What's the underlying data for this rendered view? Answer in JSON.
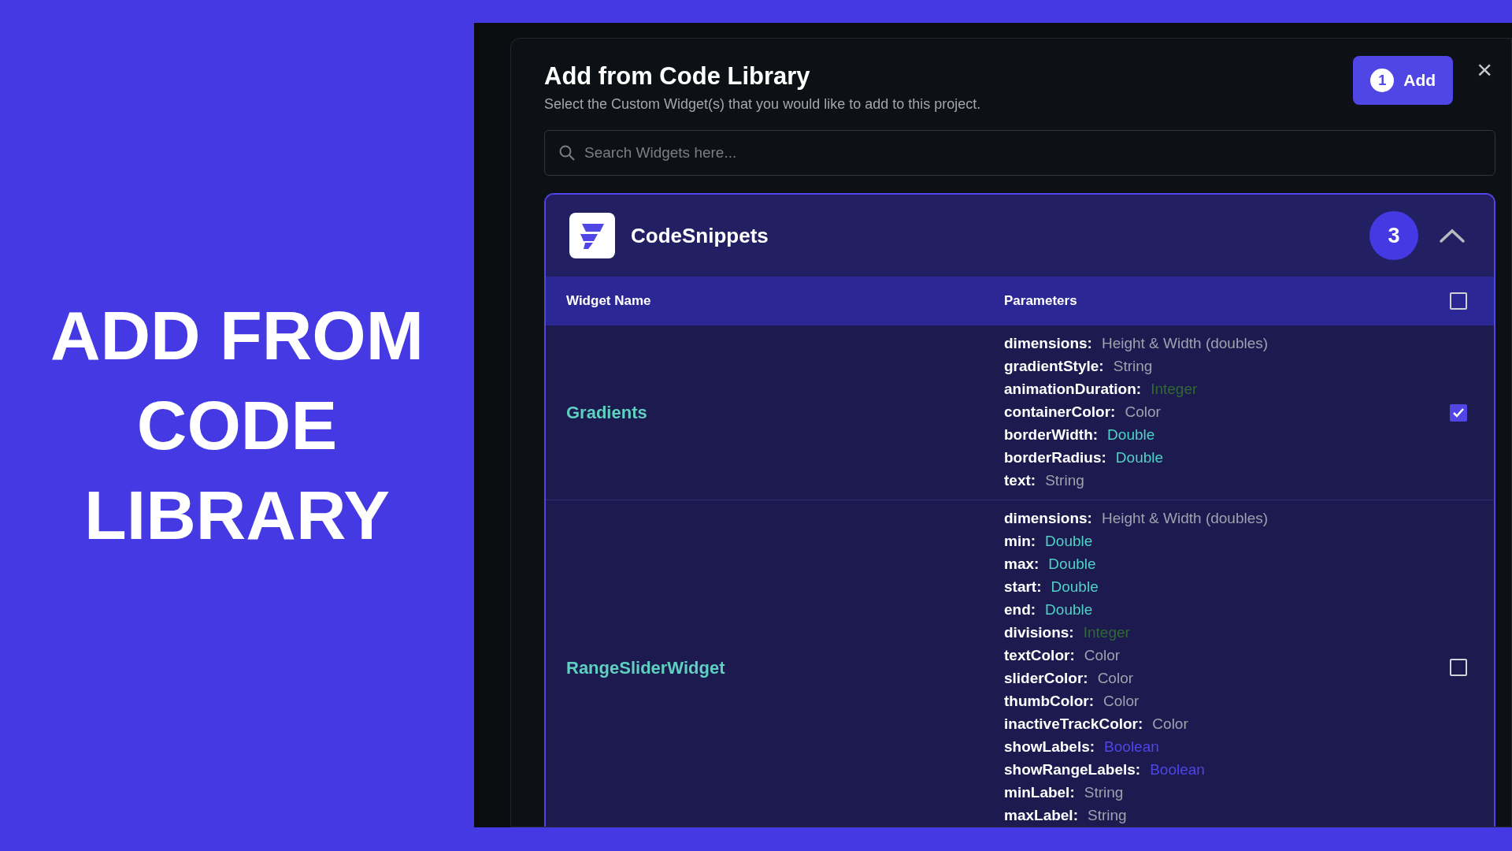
{
  "headline": [
    "ADD FROM",
    "CODE",
    "LIBRARY"
  ],
  "dialog": {
    "title": "Add from Code Library",
    "subtitle": "Select the Custom Widget(s) that you would like to add to this project.",
    "add_button": {
      "count": "1",
      "label": "Add"
    },
    "close": "×"
  },
  "search": {
    "placeholder": "Search Widgets here..."
  },
  "library": {
    "name": "CodeSnippets",
    "count": "3",
    "expanded": true,
    "columns": [
      "Widget Name",
      "Parameters"
    ],
    "all_checked": false,
    "rows": [
      {
        "name": "Gradients",
        "checked": true,
        "params": [
          {
            "name": "dimensions:",
            "type": "Height & Width (doubles)",
            "color": "#9ca3af"
          },
          {
            "name": "gradientStyle:",
            "type": "String",
            "color": "#9ca3af"
          },
          {
            "name": "animationDuration:",
            "type": "Integer",
            "color": "#2f6b2f"
          },
          {
            "name": "containerColor:",
            "type": "Color",
            "color": "#9ca3af"
          },
          {
            "name": "borderWidth:",
            "type": "Double",
            "color": "#4fd1c5"
          },
          {
            "name": "borderRadius:",
            "type": "Double",
            "color": "#4fd1c5"
          },
          {
            "name": "text:",
            "type": "String",
            "color": "#9ca3af"
          }
        ]
      },
      {
        "name": "RangeSliderWidget",
        "checked": false,
        "params": [
          {
            "name": "dimensions:",
            "type": "Height & Width (doubles)",
            "color": "#9ca3af"
          },
          {
            "name": "min:",
            "type": "Double",
            "color": "#4fd1c5"
          },
          {
            "name": "max:",
            "type": "Double",
            "color": "#4fd1c5"
          },
          {
            "name": "start:",
            "type": "Double",
            "color": "#4fd1c5"
          },
          {
            "name": "end:",
            "type": "Double",
            "color": "#4fd1c5"
          },
          {
            "name": "divisions:",
            "type": "Integer",
            "color": "#2f6b2f"
          },
          {
            "name": "textColor:",
            "type": "Color",
            "color": "#9ca3af"
          },
          {
            "name": "sliderColor:",
            "type": "Color",
            "color": "#9ca3af"
          },
          {
            "name": "thumbColor:",
            "type": "Color",
            "color": "#9ca3af"
          },
          {
            "name": "inactiveTrackColor:",
            "type": "Color",
            "color": "#9ca3af"
          },
          {
            "name": "showLabels:",
            "type": "Boolean",
            "color": "#4f46e5"
          },
          {
            "name": "showRangeLabels:",
            "type": "Boolean",
            "color": "#4f46e5"
          },
          {
            "name": "minLabel:",
            "type": "String",
            "color": "#9ca3af"
          },
          {
            "name": "maxLabel:",
            "type": "String",
            "color": "#9ca3af"
          }
        ]
      }
    ]
  }
}
